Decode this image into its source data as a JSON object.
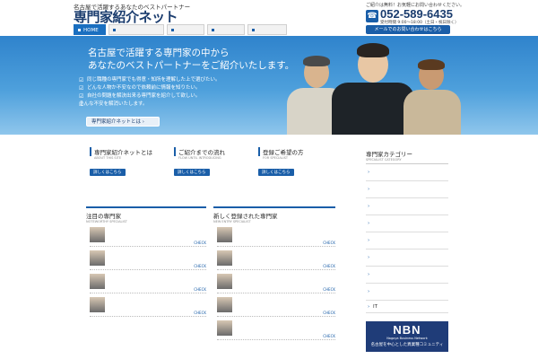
{
  "header": {
    "tagline": "名古屋で活躍するあなたのベストパートナー",
    "logo": "専門家紹介ネット",
    "description": "",
    "contact_note": "ご紹介は無料！お気軽にお問い合わせください。",
    "phone": "052-589-6435",
    "hours": "受付時間 9:00～18:00（土日・祝日除く）",
    "mail_button": "メールでのお問い合わせはこちら"
  },
  "nav": [
    "HOME",
    "",
    "",
    "",
    ""
  ],
  "hero": {
    "heading_line1": "名古屋で活躍する専門家の中から",
    "heading_line2": "あなたのベストパートナーをご紹介いたします。",
    "bullets": [
      "同じ職種の専門家でも得意・知所を理解した上で選びたい。",
      "どんな人物か不安なので依頼前に情報を知りたい。",
      "自社の問題を解決出来る専門家を紹介して欲しい。"
    ],
    "closing": "そんな不安を解消いたします。",
    "cta": "専門家紹介ネットとは"
  },
  "info_boxes": [
    {
      "title": "専門家紹介ネットとは",
      "subtitle": "ABOUT THIS SITE",
      "text": "",
      "button": "詳しくはこちら"
    },
    {
      "title": "ご紹介までの流れ",
      "subtitle": "FLOW UNTIL INTRODUCING",
      "text": "",
      "button": "詳しくはこちら"
    },
    {
      "title": "登録ご希望の方",
      "subtitle": "FOR SPECIALIST",
      "text": "",
      "button": "詳しくはこちら"
    }
  ],
  "featured": {
    "title": "注目の専門家",
    "subtitle": "NOTEWORTHY SPECIALIST",
    "items": [
      {
        "text": "",
        "name": "",
        "check": "CHECK"
      },
      {
        "text": "",
        "name": "",
        "check": "CHECK"
      },
      {
        "text": "",
        "name": "",
        "check": "CHECK"
      },
      {
        "text": "",
        "name": "",
        "check": "CHECK"
      }
    ]
  },
  "new_entries": {
    "title": "新しく登録された専門家",
    "subtitle": "NEW ENTRY SPECIALIST",
    "items": [
      {
        "text": "",
        "name": "",
        "check": "CHECK"
      },
      {
        "text": "",
        "name": "",
        "check": "CHECK"
      },
      {
        "text": "",
        "name": "",
        "check": "CHECK"
      },
      {
        "text": "",
        "name": "",
        "check": "CHECK"
      },
      {
        "text": "",
        "name": "",
        "check": "CHECK"
      }
    ]
  },
  "sidebar": {
    "title": "専門家カテゴリー",
    "subtitle": "SPECIALIST CATEGORY",
    "items": [
      "",
      "",
      "",
      "",
      "",
      "",
      "",
      "",
      "IT",
      ""
    ],
    "banner_big": "NBN",
    "banner_small": "Nagoya Business Network",
    "banner_caption": "名古屋を中心とした異業種コミュニティ"
  },
  "colors": {
    "brand": "#1a5ea8",
    "hero_top": "#2f83cc",
    "logo": "#1a3c6e"
  }
}
